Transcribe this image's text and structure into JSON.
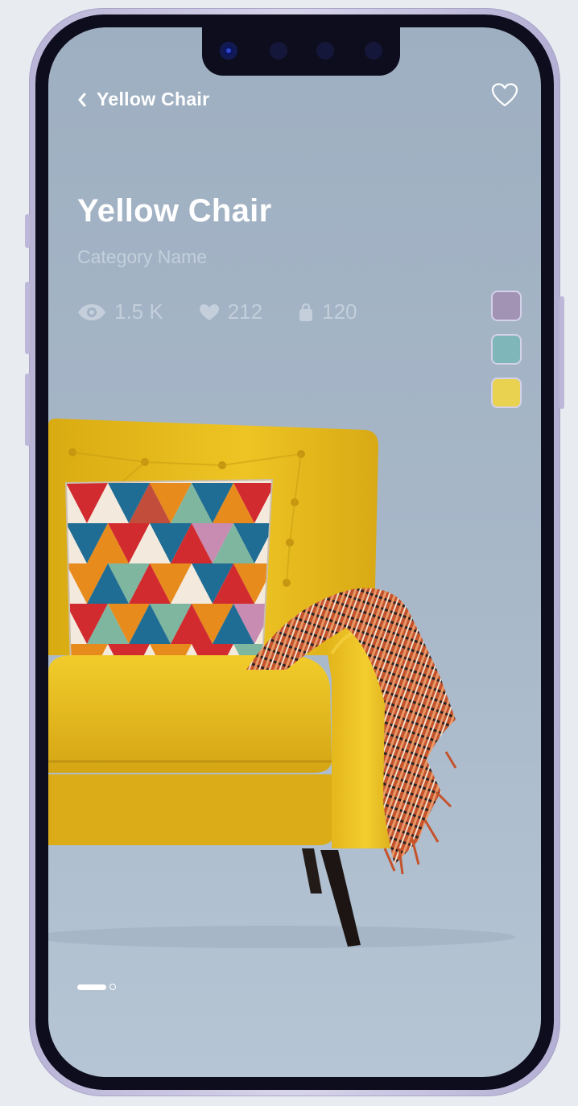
{
  "header": {
    "back_label": "Yellow Chair",
    "back_icon": "chevron-left-icon",
    "favorite_icon": "heart-outline-icon"
  },
  "product": {
    "name": "Yellow Chair",
    "category": "Category Name"
  },
  "stats": [
    {
      "icon": "eye-icon",
      "value": "1.5 K"
    },
    {
      "icon": "heart-icon",
      "value": "212"
    },
    {
      "icon": "bag-icon",
      "value": "120"
    }
  ],
  "color_options": [
    "#a292b3",
    "#7eb6ba",
    "#e8d24f"
  ],
  "carousel": {
    "slides": 2,
    "active_index": 0
  },
  "colors": {
    "background": "#a7b7c8",
    "text_primary": "#ffffff",
    "text_muted": "#c4cfdb",
    "chair": "#e8bd1c"
  }
}
